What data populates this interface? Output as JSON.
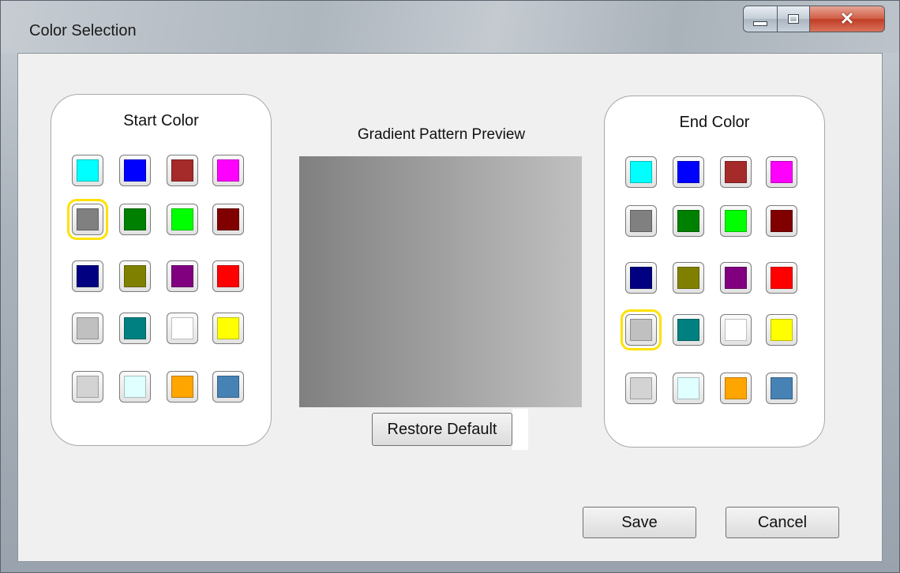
{
  "window": {
    "title": "Color Selection",
    "controls": {
      "minimize": "minimize-icon",
      "maximize": "maximize-icon",
      "close": "close-icon"
    }
  },
  "start_panel": {
    "title": "Start Color",
    "selected_index": 4,
    "swatches": [
      "#00ffff",
      "#0000ff",
      "#a52a2a",
      "#ff00ff",
      "#808080",
      "#008000",
      "#00ff00",
      "#800000",
      "#000080",
      "#808000",
      "#800080",
      "#ff0000",
      "#c0c0c0",
      "#008080",
      "#ffffff",
      "#ffff00",
      "#d3d3d3",
      "#e0ffff",
      "#ffa500",
      "#4682b4"
    ]
  },
  "end_panel": {
    "title": "End Color",
    "selected_index": 12,
    "swatches": [
      "#00ffff",
      "#0000ff",
      "#a52a2a",
      "#ff00ff",
      "#808080",
      "#008000",
      "#00ff00",
      "#800000",
      "#000080",
      "#808000",
      "#800080",
      "#ff0000",
      "#c0c0c0",
      "#008080",
      "#ffffff",
      "#ffff00",
      "#d3d3d3",
      "#e0ffff",
      "#ffa500",
      "#4682b4"
    ]
  },
  "preview": {
    "label": "Gradient Pattern Preview",
    "restore_label": "Restore Default"
  },
  "footer": {
    "save_label": "Save",
    "cancel_label": "Cancel"
  }
}
